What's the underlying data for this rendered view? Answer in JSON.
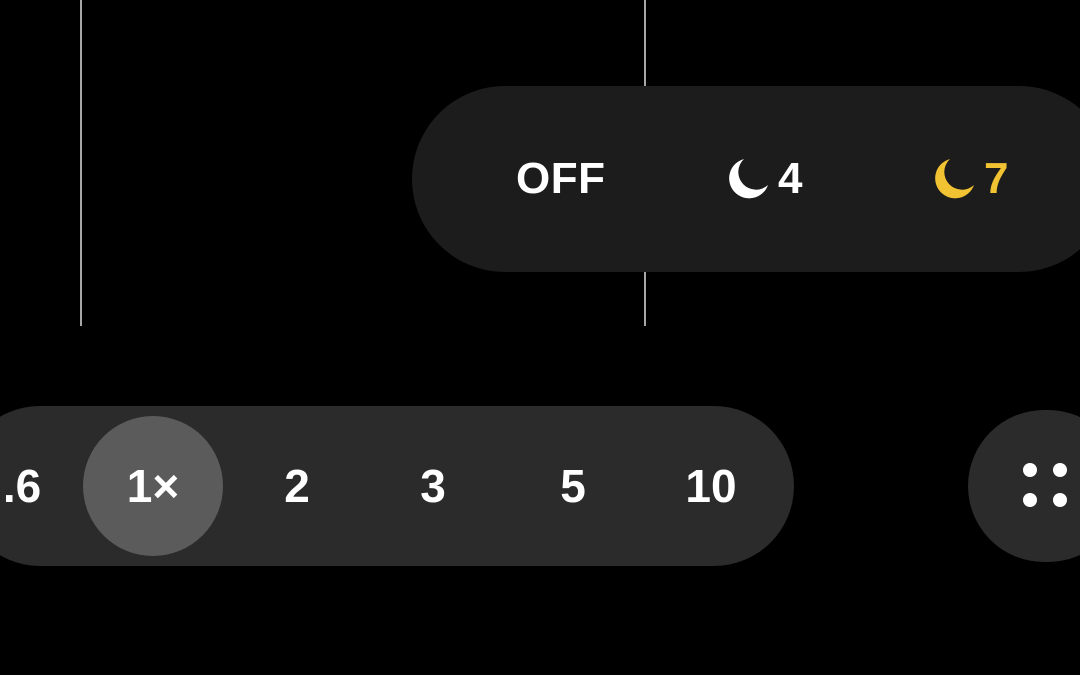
{
  "timer": {
    "off_label": "OFF",
    "option_4_label": "4",
    "option_7_label": "7",
    "selected_color": "#f1c232",
    "icon": "moon-icon"
  },
  "zoom": {
    "options": [
      ".6",
      "1×",
      "2",
      "3",
      "5",
      "10"
    ],
    "selected": "1×"
  },
  "more_button": {
    "icon": "dots-grid-icon"
  }
}
